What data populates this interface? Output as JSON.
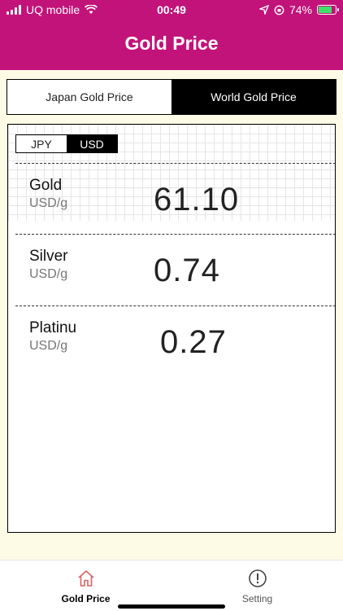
{
  "status": {
    "carrier": "UQ mobile",
    "time": "00:49",
    "battery": "74%"
  },
  "header": {
    "title": "Gold Price"
  },
  "tabs": [
    {
      "label": "Japan Gold Price",
      "active": false
    },
    {
      "label": "World Gold Price",
      "active": true
    }
  ],
  "currency_toggle": {
    "options": [
      "JPY",
      "USD"
    ],
    "selected": "USD"
  },
  "prices": [
    {
      "name": "Gold",
      "unit": "USD/g",
      "value": "61.10"
    },
    {
      "name": "Silver",
      "unit": "USD/g",
      "value": "0.74"
    },
    {
      "name": "Platinu",
      "unit": "USD/g",
      "value": "0.27"
    }
  ],
  "bottom_nav": [
    {
      "label": "Gold Price",
      "icon": "home-icon",
      "active": true
    },
    {
      "label": "Setting",
      "icon": "exclamation-circle-icon",
      "active": false
    }
  ],
  "colors": {
    "header": "#c2137a",
    "home_icon": "#e06060"
  }
}
